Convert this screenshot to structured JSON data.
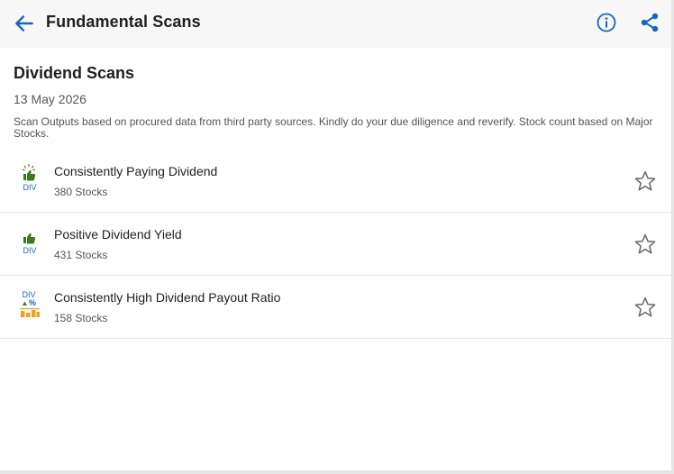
{
  "header": {
    "title": "Fundamental Scans",
    "back_icon": "arrow-left-icon",
    "info_icon": "info-icon",
    "share_icon": "share-icon"
  },
  "section": {
    "title": "Dividend Scans",
    "date": "13 May 2026",
    "disclaimer": "Scan Outputs based on procured data from third party sources. Kindly do your due diligence and reverify. Stock count based on Major Stocks."
  },
  "scans": [
    {
      "name": "Consistently Paying Dividend",
      "count": "380 Stocks",
      "icon": "dividend-thumbs-up-sparkle-icon",
      "icon_text": "DIV"
    },
    {
      "name": "Positive Dividend Yield",
      "count": "431 Stocks",
      "icon": "dividend-thumbs-up-icon",
      "icon_text": "DIV"
    },
    {
      "name": "Consistently High Dividend Payout Ratio",
      "count": "158 Stocks",
      "icon": "dividend-payout-chart-icon",
      "icon_text": "DIV"
    }
  ],
  "colors": {
    "accent": "#1565c0",
    "header_bg": "#f7f7f7",
    "thumb_green": "#3a7a1e",
    "bar_orange": "#f0a020",
    "star_outline": "#666666"
  }
}
